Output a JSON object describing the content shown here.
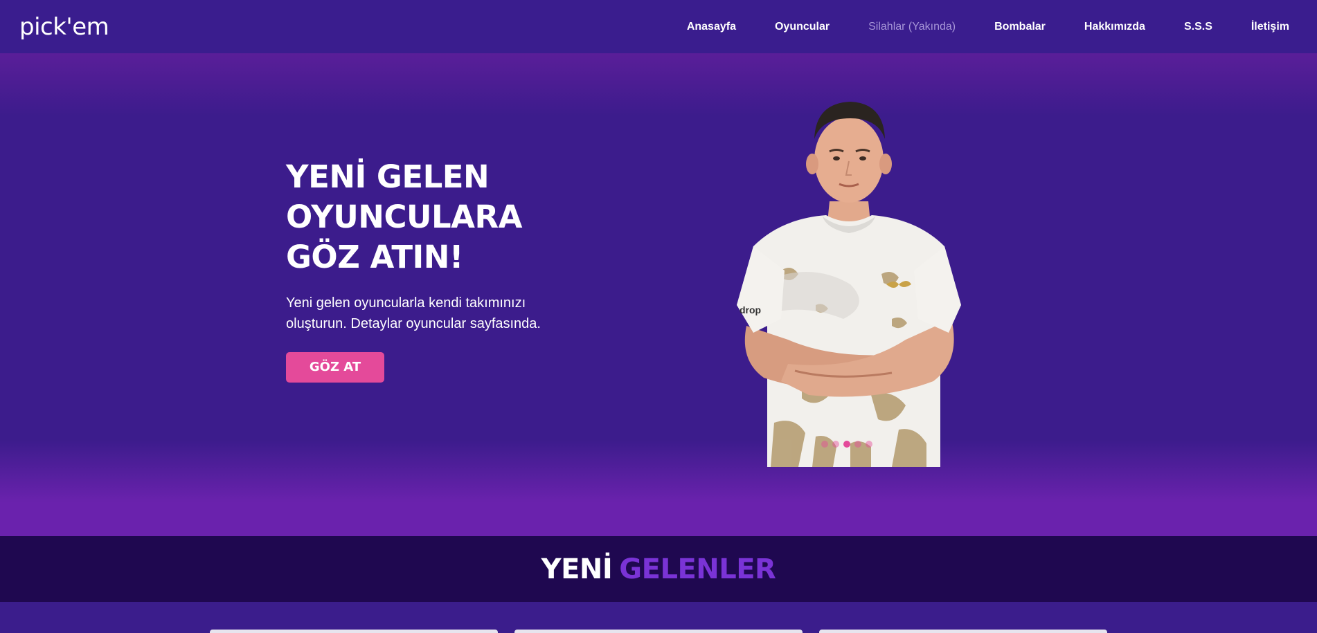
{
  "brand": "pick'em",
  "nav": {
    "items": [
      {
        "label": "Anasayfa",
        "disabled": false
      },
      {
        "label": "Oyuncular",
        "disabled": false
      },
      {
        "label": "Silahlar (Yakında)",
        "disabled": true
      },
      {
        "label": "Bombalar",
        "disabled": false
      },
      {
        "label": "Hakkımızda",
        "disabled": false
      },
      {
        "label": "S.S.S",
        "disabled": false
      },
      {
        "label": "İletişim",
        "disabled": false
      }
    ]
  },
  "hero": {
    "title_line1": "YENİ GELEN",
    "title_line2": "OYUNCULARA",
    "title_line3": "GÖZ ATIN!",
    "description": "Yeni gelen oyuncularla kendi takımınızı oluşturun. Detaylar oyuncular sayfasında.",
    "button_label": "GÖZ AT",
    "slide_count": 5,
    "active_slide": 3
  },
  "section": {
    "title_word1": "YENİ",
    "title_word2": "GELENLER"
  },
  "colors": {
    "accent_pink": "#e44a9a",
    "accent_purple": "#7a33d6",
    "nav_bg": "#3a1d8e",
    "section_bg": "#1f0850"
  }
}
